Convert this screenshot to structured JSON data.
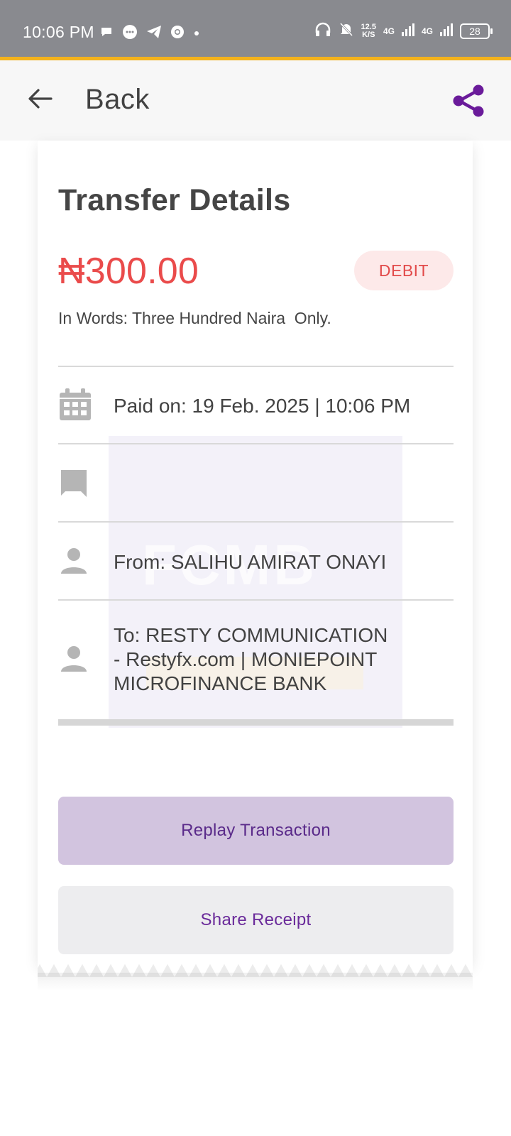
{
  "status_bar": {
    "time": "10:06 PM",
    "notification_icons": [
      "chat-bubble-icon",
      "messenger-icon",
      "telegram-icon",
      "chrome-icon",
      "dot-icon"
    ],
    "net_speed_value": "12.5",
    "net_speed_unit": "K/S",
    "network_1": "4G",
    "network_2": "4G",
    "battery": "28"
  },
  "header": {
    "back_label": "Back",
    "share_icon": "share-icon"
  },
  "receipt": {
    "title": "Transfer Details",
    "amount": "₦300.00",
    "badge": "DEBIT",
    "in_words": "In Words: Three Hundred Naira  Only.",
    "paid_on": "Paid on: 19 Feb. 2025 | 10:06 PM",
    "narration": "",
    "from": "From: SALIHU AMIRAT ONAYI",
    "to_line1": "To: RESTY COMMUNICATION",
    "to_line2": "- Restyfx.com | MONIEPOINT",
    "to_line3": "MICROFINANCE BANK",
    "watermark": "FCMB"
  },
  "actions": {
    "replay": "Replay Transaction",
    "share": "Share Receipt"
  },
  "colors": {
    "status_bar": "#898a8f",
    "accent": "#f3b21c",
    "amount": "#ea4b4b",
    "brand_purple": "#5a2a8a",
    "replay_bg": "#d2c4df"
  }
}
